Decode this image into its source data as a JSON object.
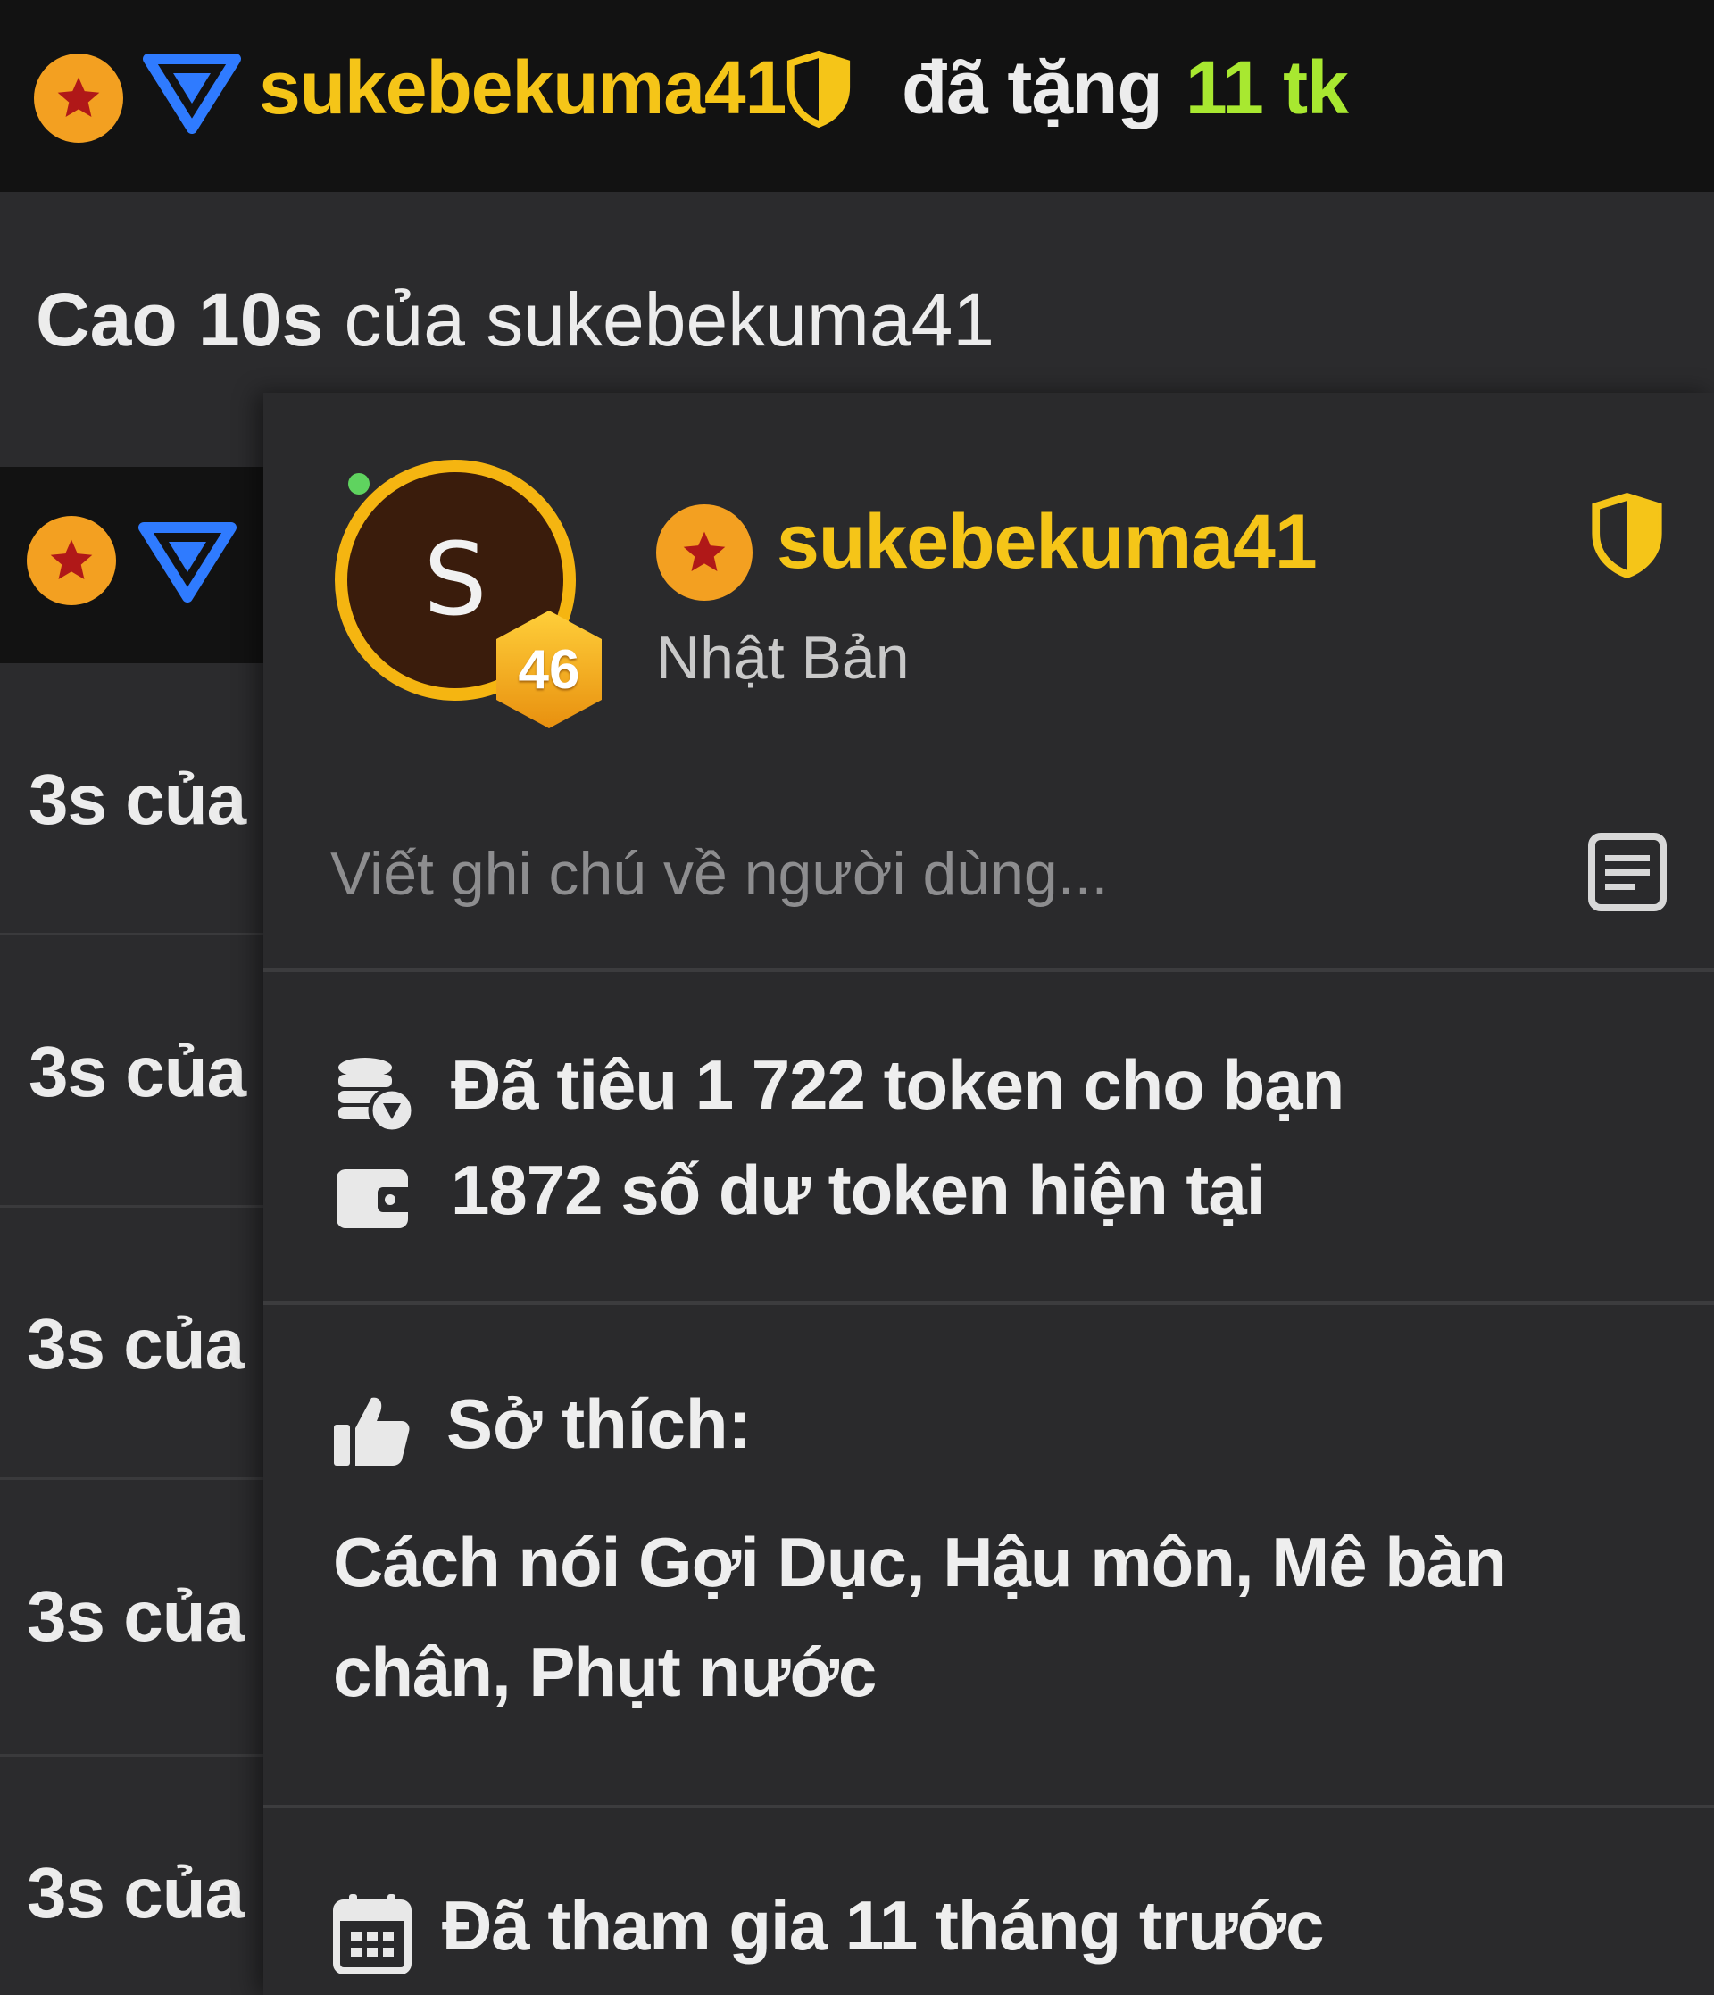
{
  "top_message": {
    "username": "sukebekuma41",
    "gift_text": "đã tặng",
    "gift_amount": "11 tk"
  },
  "chat_rows": [
    {
      "bold_part": "Cao 10s",
      "rest": "của sukebekuma41"
    },
    {
      "text": "3s của"
    },
    {
      "text": "3s của"
    },
    {
      "text": "3s của"
    },
    {
      "text": "3s của"
    },
    {
      "text": "3s của"
    }
  ],
  "profile": {
    "avatar_letter": "S",
    "level": "46",
    "username": "sukebekuma41",
    "country": "Nhật Bản",
    "note_placeholder": "Viết ghi chú về người dùng...",
    "tokens_spent": "Đã tiêu 1 722 token cho bạn",
    "tokens_balance": "1872 số dư token hiện tại",
    "interests_label": "Sở thích:",
    "interests_line1": "Cách nói Gợi Dục, Hậu môn, Mê bàn",
    "interests_line2": "chân, Phụt nước",
    "joined": "Đã tham gia 11 tháng trước"
  },
  "colors": {
    "username_gold": "#f5c518",
    "gift_green": "#a8e830",
    "star_orange": "#f3a021",
    "star_red": "#b01818",
    "triangle_blue": "#2f7bff",
    "online_green": "#5fd35f"
  },
  "icons": [
    "star-badge-icon",
    "blue-triangle-icon",
    "shield-icon",
    "note-icon",
    "coins-icon",
    "wallet-icon",
    "thumbs-up-icon",
    "calendar-icon"
  ]
}
